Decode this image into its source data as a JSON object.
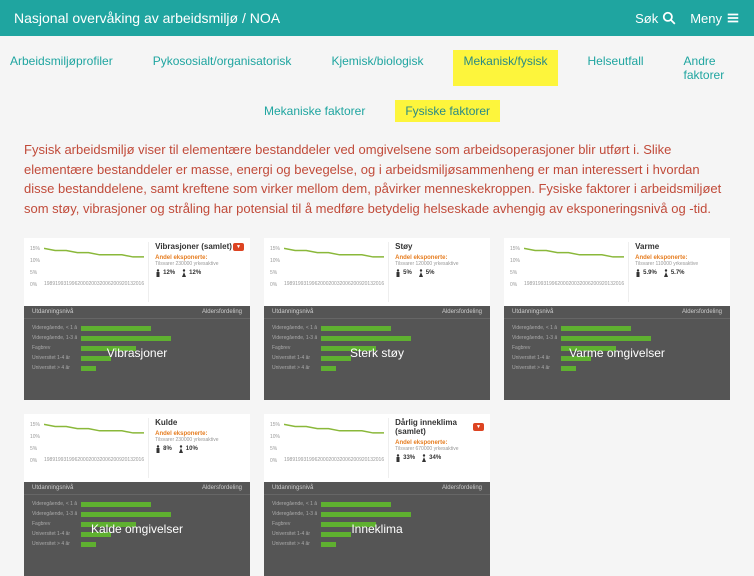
{
  "header": {
    "title": "Nasjonal overvåking av arbeidsmiljø / NOA",
    "search": "Søk",
    "menu": "Meny"
  },
  "nav": {
    "items": [
      {
        "label": "Arbeidsmiljøprofiler",
        "active": false
      },
      {
        "label": "Pykososialt/organisatorisk",
        "active": false
      },
      {
        "label": "Kjemisk/biologisk",
        "active": false
      },
      {
        "label": "Mekanisk/fysisk",
        "active": true
      },
      {
        "label": "Helseutfall",
        "active": false
      },
      {
        "label": "Andre faktorer",
        "active": false
      }
    ]
  },
  "subnav": {
    "items": [
      {
        "label": "Mekaniske faktorer",
        "active": false
      },
      {
        "label": "Fysiske faktorer",
        "active": true
      }
    ]
  },
  "intro": "Fysisk arbeidsmiljø viser til elementære bestanddeler ved omgivelsene som arbeidsoperasjoner blir utført i. Slike elementære bestanddeler er masse, energi og bevegelse, og i arbeidsmiljøsammenheng er man interessert i hvordan disse bestanddelene, samt kreftene som virker mellom dem, påvirker menneskekroppen. Fysiske faktorer i arbeidsmiljøet som støy, vibrasjoner og stråling har potensial til å medføre betydelig helseskade avhengig av eksponeringsnivå og -tid.",
  "cards": [
    {
      "chart_title": "Vibrasjoner (samlet)",
      "badge": true,
      "exposed_label": "Andel eksponerte:",
      "exposed_sub": "Tilsvarer 230000 yrkesaktive",
      "pct_m": "12%",
      "pct_f": "12%",
      "label": "Vibrasjoner",
      "sub1_label": "Utdanningsnivå",
      "sub2_label": "Aldersfordeling",
      "highlight": false
    },
    {
      "chart_title": "Støy",
      "badge": false,
      "exposed_label": "Andel eksponerte:",
      "exposed_sub": "Tilsvarer 120000 yrkesaktive",
      "pct_m": "5%",
      "pct_f": "5%",
      "label": "Sterk støy",
      "sub1_label": "Utdanningsnivå",
      "sub2_label": "Aldersfordeling",
      "highlight": true
    },
    {
      "chart_title": "Varme",
      "badge": false,
      "exposed_label": "Andel eksponerte:",
      "exposed_sub": "Tilsvarer 110000 yrkesaktive",
      "pct_m": "5.9%",
      "pct_f": "5.7%",
      "label": "Varme omgivelser",
      "sub1_label": "Utdanningsnivå",
      "sub2_label": "Aldersfordeling",
      "highlight": false
    },
    {
      "chart_title": "Kulde",
      "badge": false,
      "exposed_label": "Andel eksponerte:",
      "exposed_sub": "Tilsvarer 230000 yrkesaktive",
      "pct_m": "8%",
      "pct_f": "10%",
      "label": "Kalde omgivelser",
      "sub1_label": "Utdanningsnivå",
      "sub2_label": "Aldersfordeling",
      "highlight": false
    },
    {
      "chart_title": "Dårlig inneklima (samlet)",
      "badge": true,
      "exposed_label": "Andel eksponerte:",
      "exposed_sub": "Tilsvarer 670000 yrkesaktive",
      "pct_m": "33%",
      "pct_f": "34%",
      "label": "Inneklima",
      "sub1_label": "Utdanningsnivå",
      "sub2_label": "Aldersfordeling",
      "highlight": false
    }
  ],
  "chart_data": {
    "type": "line",
    "series_shape": [
      12,
      11,
      11,
      10,
      10,
      9,
      9,
      9,
      8,
      8
    ],
    "ylim": [
      0,
      15
    ],
    "x_ticks": [
      "1989",
      "1993",
      "1996",
      "2000",
      "2003",
      "2006",
      "2009",
      "2013",
      "2016"
    ],
    "bar_rows": [
      {
        "label": "Videregående, < 1 år",
        "v": 70
      },
      {
        "label": "Videregående, 1-3 år",
        "v": 90
      },
      {
        "label": "Fagbrev",
        "v": 55
      },
      {
        "label": "Universitet 1-4 år",
        "v": 30
      },
      {
        "label": "Universitet > 4 år",
        "v": 15
      }
    ]
  }
}
